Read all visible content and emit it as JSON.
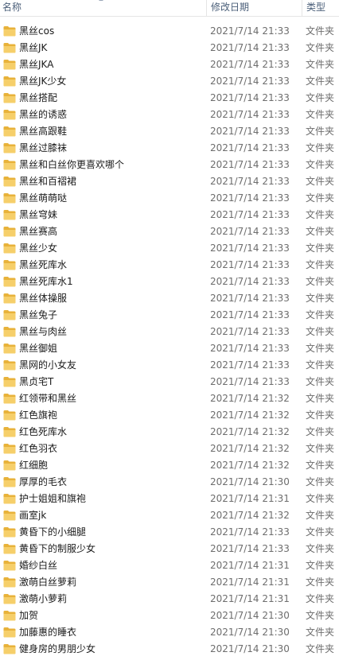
{
  "header": {
    "name": "名称",
    "date": "修改日期",
    "type": "类型"
  },
  "files": [
    {
      "name": "黑丝cos",
      "date": "2021/7/14 21:33",
      "type": "文件夹"
    },
    {
      "name": "黑丝JK",
      "date": "2021/7/14 21:33",
      "type": "文件夹"
    },
    {
      "name": "黑丝JKA",
      "date": "2021/7/14 21:33",
      "type": "文件夹"
    },
    {
      "name": "黑丝JK少女",
      "date": "2021/7/14 21:33",
      "type": "文件夹"
    },
    {
      "name": "黑丝搭配",
      "date": "2021/7/14 21:33",
      "type": "文件夹"
    },
    {
      "name": "黑丝的诱惑",
      "date": "2021/7/14 21:33",
      "type": "文件夹"
    },
    {
      "name": "黑丝高跟鞋",
      "date": "2021/7/14 21:33",
      "type": "文件夹"
    },
    {
      "name": "黑丝过膝袜",
      "date": "2021/7/14 21:33",
      "type": "文件夹"
    },
    {
      "name": "黑丝和白丝你更喜欢哪个",
      "date": "2021/7/14 21:33",
      "type": "文件夹"
    },
    {
      "name": "黑丝和百褶裙",
      "date": "2021/7/14 21:33",
      "type": "文件夹"
    },
    {
      "name": "黑丝萌萌哒",
      "date": "2021/7/14 21:33",
      "type": "文件夹"
    },
    {
      "name": "黑丝穹妹",
      "date": "2021/7/14 21:33",
      "type": "文件夹"
    },
    {
      "name": "黑丝赛高",
      "date": "2021/7/14 21:33",
      "type": "文件夹"
    },
    {
      "name": "黑丝少女",
      "date": "2021/7/14 21:33",
      "type": "文件夹"
    },
    {
      "name": "黑丝死库水",
      "date": "2021/7/14 21:33",
      "type": "文件夹"
    },
    {
      "name": "黑丝死库水1",
      "date": "2021/7/14 21:33",
      "type": "文件夹"
    },
    {
      "name": "黑丝体操服",
      "date": "2021/7/14 21:33",
      "type": "文件夹"
    },
    {
      "name": "黑丝兔子",
      "date": "2021/7/14 21:33",
      "type": "文件夹"
    },
    {
      "name": "黑丝与肉丝",
      "date": "2021/7/14 21:33",
      "type": "文件夹"
    },
    {
      "name": "黑丝御姐",
      "date": "2021/7/14 21:33",
      "type": "文件夹"
    },
    {
      "name": "黑网的小女友",
      "date": "2021/7/14 21:33",
      "type": "文件夹"
    },
    {
      "name": "黑贞宅T",
      "date": "2021/7/14 21:33",
      "type": "文件夹"
    },
    {
      "name": "红领带和黑丝",
      "date": "2021/7/14 21:32",
      "type": "文件夹"
    },
    {
      "name": "红色旗袍",
      "date": "2021/7/14 21:32",
      "type": "文件夹"
    },
    {
      "name": "红色死库水",
      "date": "2021/7/14 21:32",
      "type": "文件夹"
    },
    {
      "name": "红色羽衣",
      "date": "2021/7/14 21:32",
      "type": "文件夹"
    },
    {
      "name": "红细胞",
      "date": "2021/7/14 21:32",
      "type": "文件夹"
    },
    {
      "name": "厚厚的毛衣",
      "date": "2021/7/14 21:30",
      "type": "文件夹"
    },
    {
      "name": "护士姐姐和旗袍",
      "date": "2021/7/14 21:31",
      "type": "文件夹"
    },
    {
      "name": "画室jk",
      "date": "2021/7/14 21:32",
      "type": "文件夹"
    },
    {
      "name": "黄昏下的小细腿",
      "date": "2021/7/14 21:33",
      "type": "文件夹"
    },
    {
      "name": "黄昏下的制服少女",
      "date": "2021/7/14 21:33",
      "type": "文件夹"
    },
    {
      "name": "婚纱白丝",
      "date": "2021/7/14 21:31",
      "type": "文件夹"
    },
    {
      "name": "激萌白丝萝莉",
      "date": "2021/7/14 21:31",
      "type": "文件夹"
    },
    {
      "name": "激萌小萝莉",
      "date": "2021/7/14 21:31",
      "type": "文件夹"
    },
    {
      "name": "加贺",
      "date": "2021/7/14 21:30",
      "type": "文件夹"
    },
    {
      "name": "加藤惠的睡衣",
      "date": "2021/7/14 21:30",
      "type": "文件夹"
    },
    {
      "name": "健身房的男朋少女",
      "date": "2021/7/14 21:30",
      "type": "文件夹"
    }
  ],
  "colors": {
    "header_text": "#4c607a",
    "meta_text": "#6d6d6d",
    "folder_yellow": "#f3c34f"
  },
  "icons": {
    "folder": "folder-icon",
    "sort": "sort-ascending-icon"
  }
}
